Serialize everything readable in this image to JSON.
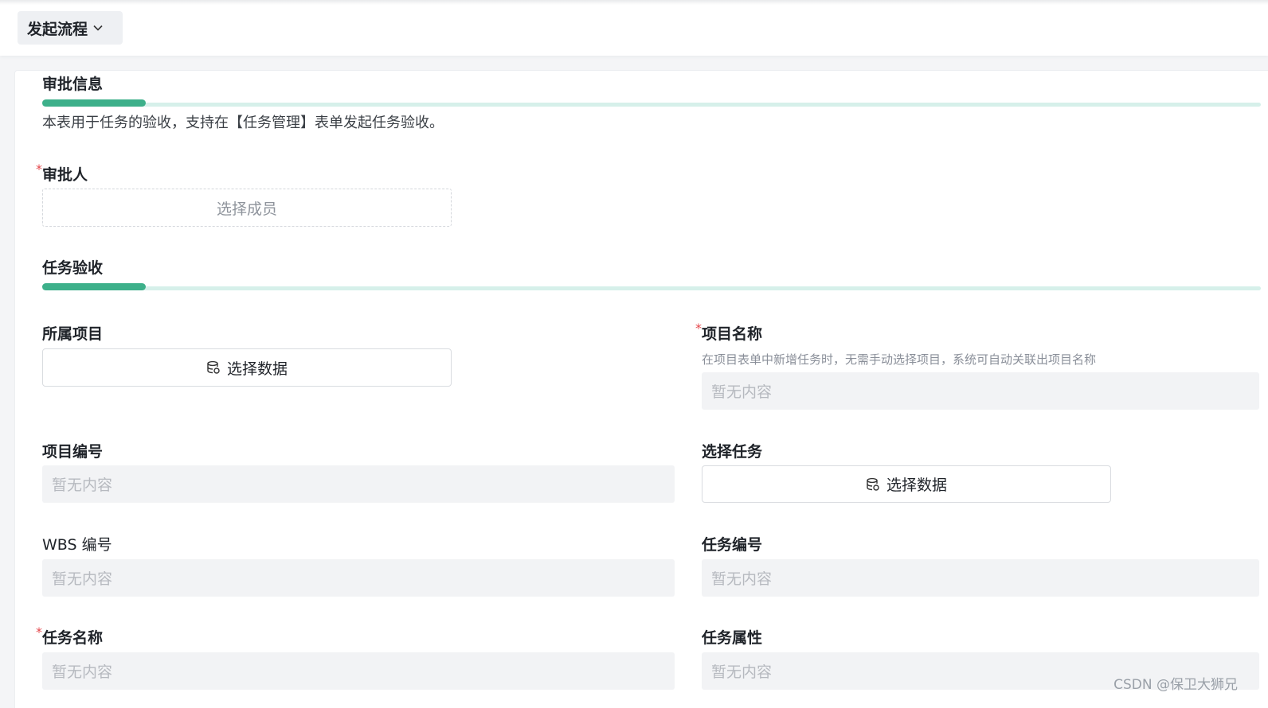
{
  "header": {
    "flow_button": "发起流程",
    "flow_button_icon": "chevron-down-icon"
  },
  "approval": {
    "title": "审批信息",
    "description": "本表用于任务的验收，支持在【任务管理】表单发起任务验收。",
    "approver_label": "审批人",
    "approver_required": "*",
    "approver_placeholder": "选择成员"
  },
  "acceptance": {
    "title": "任务验收",
    "project_label": "所属项目",
    "project_button": "选择数据",
    "project_name_label": "项目名称",
    "project_name_required": "*",
    "project_name_hint": "在项目表单中新增任务时，无需手动选择项目，系统可自动关联出项目名称",
    "project_name_value": "暂无内容",
    "project_code_label": "项目编号",
    "project_code_value": "暂无内容",
    "select_task_label": "选择任务",
    "select_task_button": "选择数据",
    "wbs_label": "WBS 编号",
    "wbs_value": "暂无内容",
    "task_code_label": "任务编号",
    "task_code_value": "暂无内容",
    "task_name_label": "任务名称",
    "task_name_required": "*",
    "task_name_value": "暂无内容",
    "task_attr_label": "任务属性",
    "task_attr_value": "暂无内容"
  },
  "watermark": "CSDN @保卫大狮兄",
  "colors": {
    "accent": "#3db08a",
    "accent_light": "#d6f0ea",
    "required": "#e5484d"
  }
}
